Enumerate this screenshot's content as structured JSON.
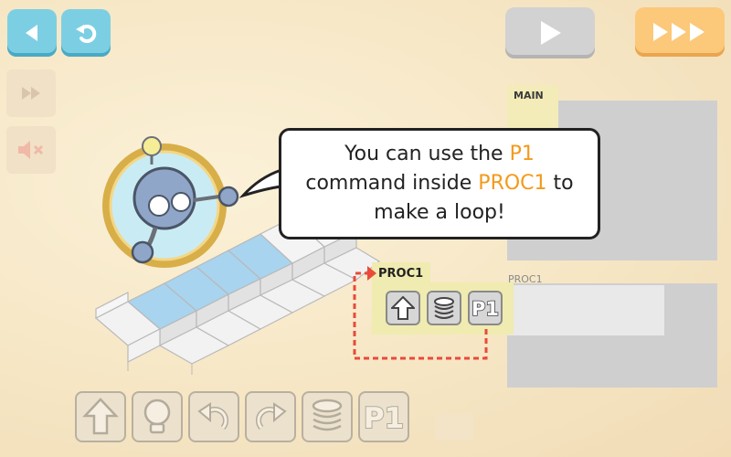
{
  "toolbar": {
    "back_icon": "arrow-left-icon",
    "undo_icon": "undo-icon",
    "play_icon": "play-icon",
    "fast_forward_icon": "triple-arrow-icon",
    "step_icon": "step-icon",
    "mute_icon": "speaker-muted-icon"
  },
  "speech": {
    "line1_a": "You can use the ",
    "line1_b": "P1",
    "line2_a": "command inside ",
    "line2_b": "PROC1",
    "line2_c": " to",
    "line3": "make a loop!"
  },
  "tutorial_proc": {
    "label": "PROC1",
    "commands": [
      {
        "name": "forward",
        "icon": "arrow-up-icon"
      },
      {
        "name": "light",
        "icon": "spring-icon"
      },
      {
        "name": "p1",
        "label": "P1"
      }
    ]
  },
  "program_panel": {
    "main_label": "MAIN",
    "proc1_label": "PROC1"
  },
  "command_palette": [
    {
      "name": "forward",
      "icon": "arrow-up-icon"
    },
    {
      "name": "light",
      "icon": "bulb-icon"
    },
    {
      "name": "turn-left",
      "icon": "turn-left-icon"
    },
    {
      "name": "turn-right",
      "icon": "turn-right-icon"
    },
    {
      "name": "jump",
      "icon": "spring-icon"
    },
    {
      "name": "p1",
      "label": "P1"
    }
  ],
  "colors": {
    "accent_blue": "#7ccfe3",
    "accent_orange": "#fcc87a",
    "highlight_text": "#f39a1c",
    "proc_highlight": "#f0ebb0"
  }
}
